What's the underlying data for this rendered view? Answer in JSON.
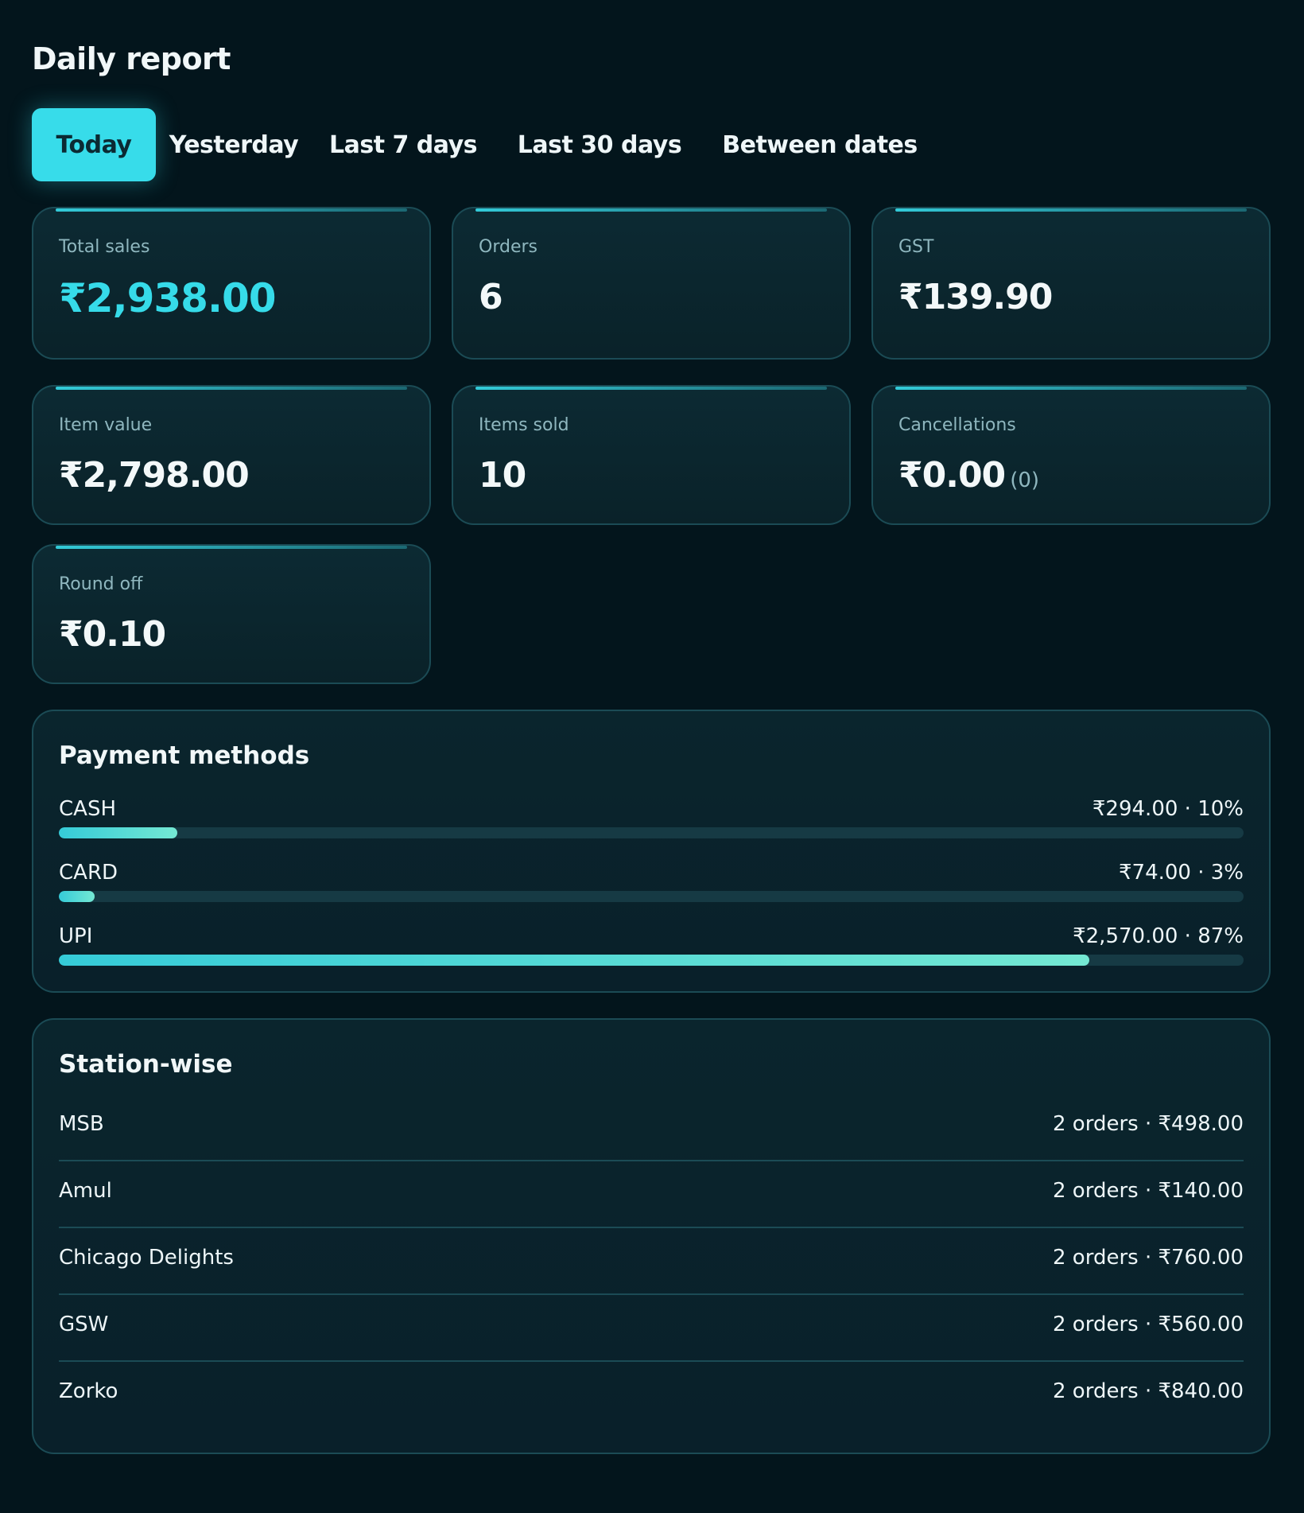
{
  "header": {
    "title": "Daily report"
  },
  "tabs": [
    {
      "label": "Today",
      "active": true
    },
    {
      "label": "Yesterday",
      "active": false
    },
    {
      "label": "Last 7 days",
      "active": false
    },
    {
      "label": "Last 30 days",
      "active": false
    },
    {
      "label": "Between dates",
      "active": false
    }
  ],
  "stats": {
    "total_sales": {
      "label": "Total sales",
      "value": "₹2,938.00"
    },
    "orders": {
      "label": "Orders",
      "value": "6"
    },
    "gst": {
      "label": "GST",
      "value": "₹139.90"
    },
    "item_value": {
      "label": "Item value",
      "value": "₹2,798.00"
    },
    "items_sold": {
      "label": "Items sold",
      "value": "10"
    },
    "cancellations": {
      "label": "Cancellations",
      "value": "₹0.00",
      "count": "(0)"
    },
    "round_off": {
      "label": "Round off",
      "value": "₹0.10"
    }
  },
  "payment_methods": {
    "title": "Payment methods",
    "items": [
      {
        "name": "CASH",
        "amount": "₹294.00 · 10%",
        "percent": 10
      },
      {
        "name": "CARD",
        "amount": "₹74.00 · 3%",
        "percent": 3
      },
      {
        "name": "UPI",
        "amount": "₹2,570.00 · 87%",
        "percent": 87
      }
    ]
  },
  "stations": {
    "title": "Station-wise",
    "items": [
      {
        "name": "MSB",
        "meta": "2 orders · ₹498.00"
      },
      {
        "name": "Amul",
        "meta": "2 orders · ₹140.00"
      },
      {
        "name": "Chicago Delights",
        "meta": "2 orders · ₹760.00"
      },
      {
        "name": "GSW",
        "meta": "2 orders · ₹560.00"
      },
      {
        "name": "Zorko",
        "meta": "2 orders · ₹840.00"
      }
    ]
  },
  "colors": {
    "accent": "#37dcea",
    "background": "#03151c",
    "card": "#0b2730",
    "border": "#1b4b55"
  }
}
